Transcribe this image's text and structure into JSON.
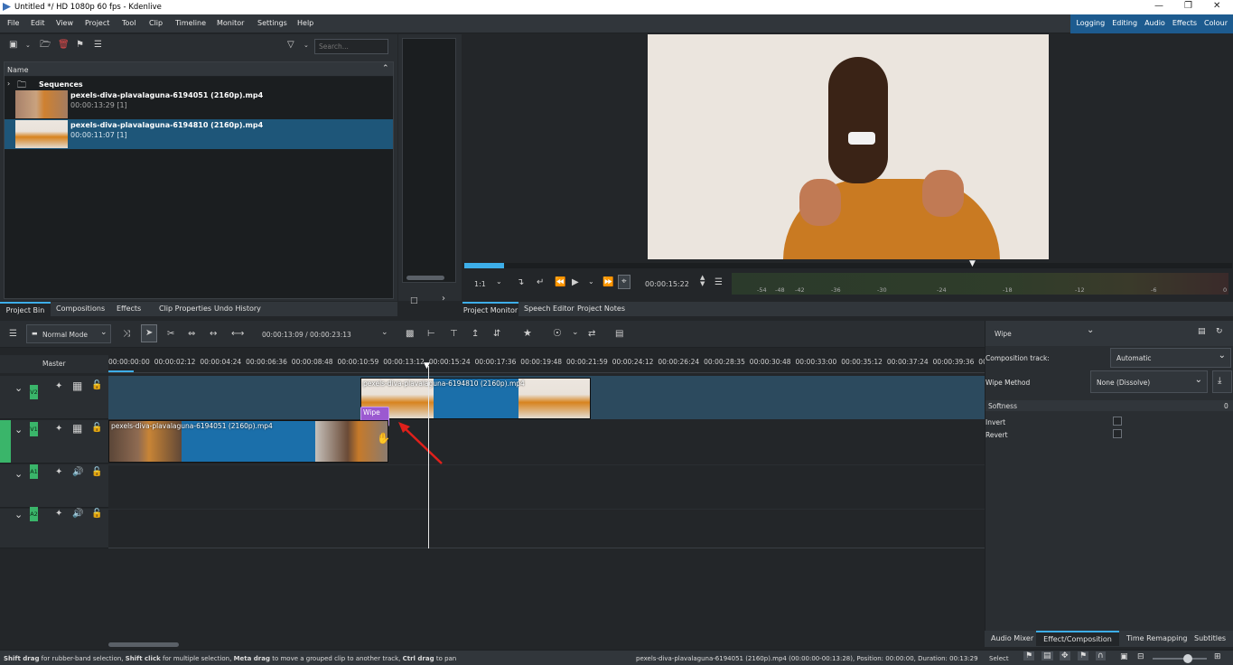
{
  "window": {
    "title": "Untitled */ HD 1080p 60 fps - Kdenlive"
  },
  "menu": [
    "File",
    "Edit",
    "View",
    "Project",
    "Tool",
    "Clip",
    "Timeline",
    "Monitor",
    "Settings",
    "Help"
  ],
  "workspaces": [
    "Logging",
    "Editing",
    "Audio",
    "Effects",
    "Colour"
  ],
  "bin": {
    "search_placeholder": "Search...",
    "column": "Name",
    "folder": "Sequences",
    "clips": [
      {
        "name": "pexels-diva-plavalaguna-6194051 (2160p).mp4",
        "meta": "00:00:13:29 [1]"
      },
      {
        "name": "pexels-diva-plavalaguna-6194810 (2160p).mp4",
        "meta": "00:00:11:07 [1]"
      }
    ]
  },
  "left_tabs": [
    "Project Bin",
    "Compositions",
    "Effects",
    "Clip Properties",
    "Undo History"
  ],
  "monitor": {
    "zoom": "1:1",
    "timecode": "00:00:15:22",
    "meter": [
      "-54",
      "-48",
      "-42",
      "-36",
      "-30",
      "-24",
      "-18",
      "-12",
      "-6",
      "0"
    ]
  },
  "monitor_tabs": [
    "Project Monitor",
    "Speech Editor",
    "Project Notes"
  ],
  "timeline": {
    "mode": "Normal Mode",
    "position": "00:00:13:09 / 00:00:23:13",
    "master": "Master",
    "ruler": [
      "00:00:00:00",
      "00:00:02:12",
      "00:00:04:24",
      "00:00:06:36",
      "00:00:08:48",
      "00:00:10:59",
      "00:00:13:12",
      "00:00:15:24",
      "00:00:17:36",
      "00:00:19:48",
      "00:00:21:59",
      "00:00:24:12",
      "00:00:26:24",
      "00:00:28:35",
      "00:00:30:48",
      "00:00:33:00",
      "00:00:35:12",
      "00:00:37:24",
      "00:00:39:36",
      "00:0"
    ],
    "tracks": [
      "V2",
      "V1",
      "A1",
      "A2"
    ],
    "clip_v2": "pexels-diva-plavalaguna-6194810 (2160p).mp4",
    "clip_v1": "pexels-diva-plavalaguna-6194051 (2160p).mp4",
    "composition": "Wipe"
  },
  "props": {
    "title": "Wipe",
    "comp_track_label": "Composition track:",
    "comp_track_value": "Automatic",
    "wipe_method_label": "Wipe Method",
    "wipe_method_value": "None (Dissolve)",
    "softness_label": "Softness",
    "softness_value": "0",
    "invert_label": "Invert",
    "revert_label": "Revert"
  },
  "right_tabs": [
    "Audio Mixer",
    "Effect/Composition St...",
    "Time Remapping",
    "Subtitles"
  ],
  "status": {
    "help": [
      [
        "Shift drag",
        " for rubber-band selection, "
      ],
      [
        "Shift click",
        " for multiple selection, "
      ],
      [
        "Meta drag",
        " to move a grouped clip to another track, "
      ],
      [
        "Ctrl drag",
        " to pan"
      ]
    ],
    "clip_info": "pexels-diva-plavalaguna-6194051 (2160p).mp4 (00:00:00-00:13:28), Position: 00:00:00, Duration: 00:13:29",
    "tool": "Select"
  },
  "colors": {
    "accent": "#3daee9",
    "selection": "#1e5679",
    "clip_blue": "#1b6faa",
    "track_green": "#3ab56a",
    "composition": "#9b59d0",
    "arrow": "#e0201b"
  }
}
